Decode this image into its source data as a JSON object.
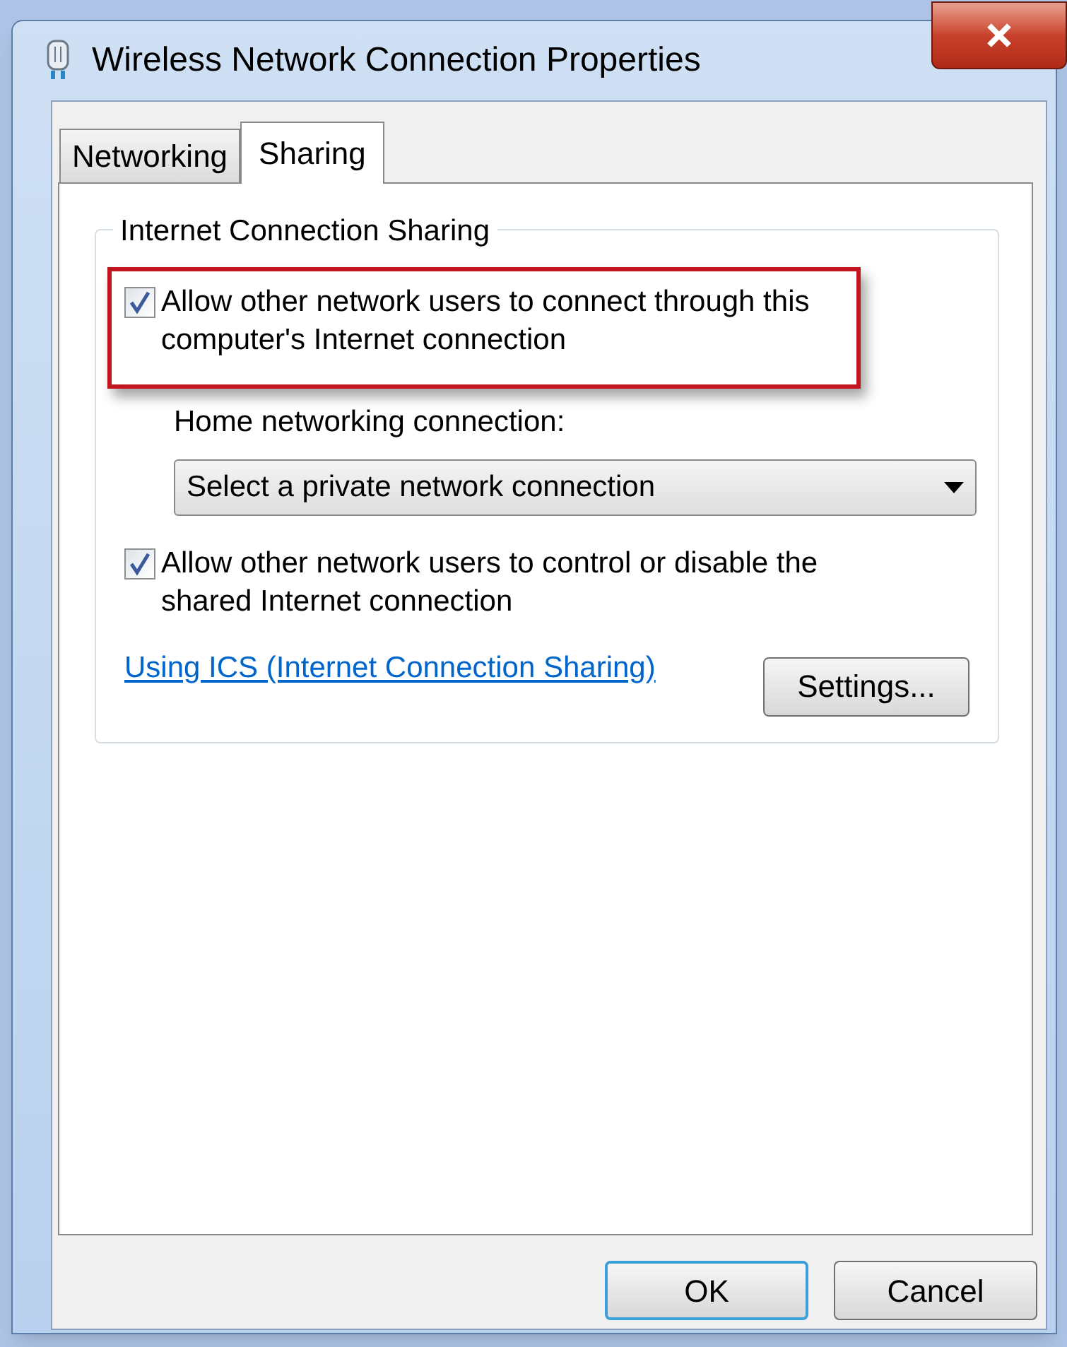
{
  "window": {
    "title": "Wireless Network Connection Properties"
  },
  "tabs": [
    {
      "label": "Networking",
      "selected": false
    },
    {
      "label": "Sharing",
      "selected": true
    }
  ],
  "group": {
    "title": "Internet Connection Sharing",
    "checkboxes": [
      {
        "label": "Allow other network users to connect through this computer's Internet connection",
        "checked": true,
        "highlighted": true
      },
      {
        "label": "Allow other network users to control or disable the shared Internet connection",
        "checked": true,
        "highlighted": false
      }
    ],
    "home_connection": {
      "label": "Home networking connection:",
      "value": "Select a private network connection"
    },
    "link": "Using ICS (Internet Connection Sharing)",
    "settings_button": "Settings..."
  },
  "buttons": [
    {
      "label": "OK",
      "default": true
    },
    {
      "label": "Cancel",
      "default": false
    }
  ]
}
